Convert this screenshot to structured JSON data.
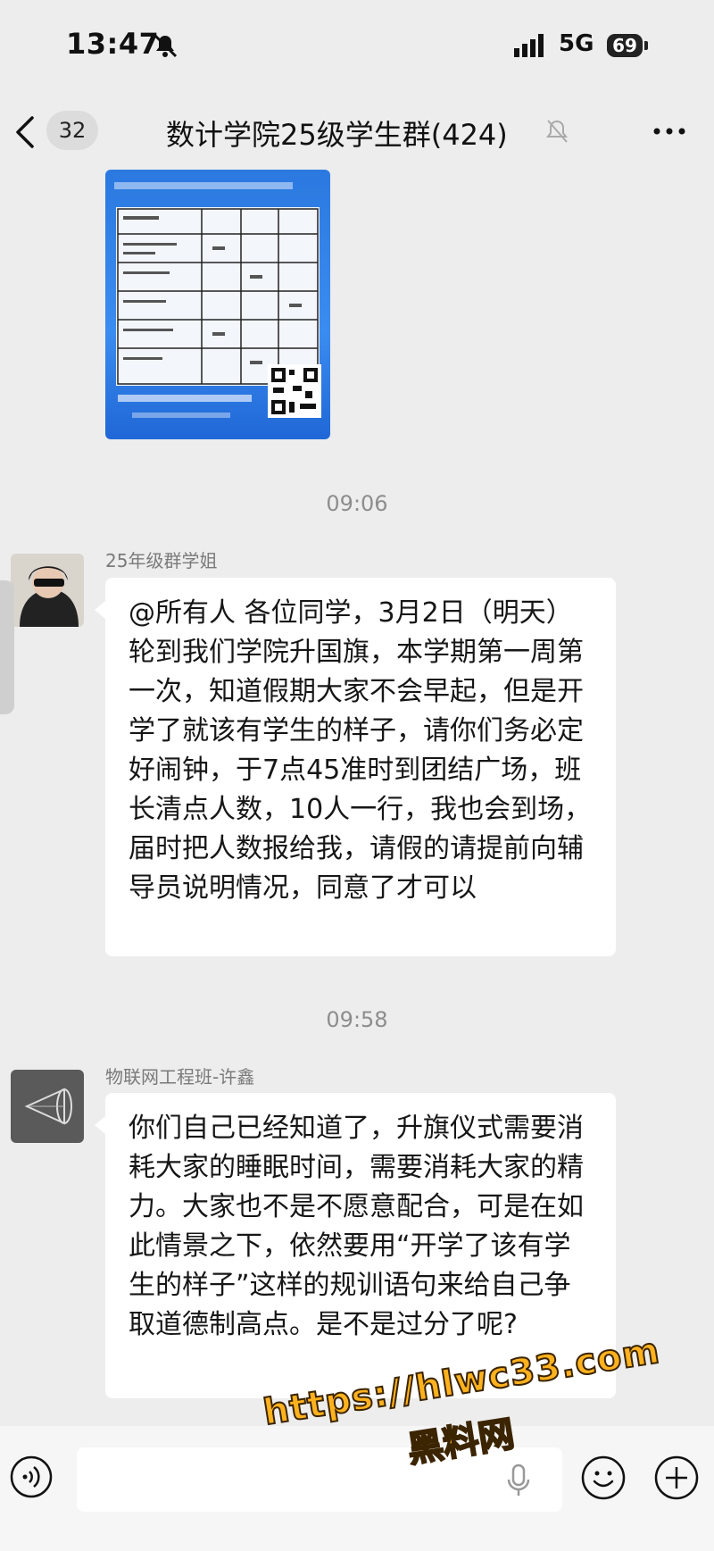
{
  "status_bar": {
    "time": "13:47",
    "network": "5G",
    "battery": "69"
  },
  "nav": {
    "unread_count": "32",
    "title": "数计学院25级学生群(424)"
  },
  "messages": [
    {
      "timestamp": "09:06",
      "sender": "25年级群学姐",
      "text": "@所有人 各位同学，3月2日（明天）轮到我们学院升国旗，本学期第一周第一次，知道假期大家不会早起，但是开学了就该有学生的样子，请你们务必定好闹钟，于7点45准时到团结广场，班长清点人数，10人一行，我也会到场，届时把人数报给我，请假的请提前向辅导员说明情况，同意了才可以"
    },
    {
      "timestamp": "09:58",
      "sender": "物联网工程班-许鑫",
      "text": "你们自己已经知道了，升旗仪式需要消耗大家的睡眠时间，需要消耗大家的精力。大家也不是不愿意配合，可是在如此情景之下，依然要用“开学了该有学生的样子”这样的规训语句来给自己争取道德制高点。是不是过分了呢?"
    }
  ],
  "watermark": {
    "url": "https://hlwc33.com",
    "name": "黑料网"
  },
  "colors": {
    "background": "#ededed",
    "bubble": "#ffffff",
    "card_blue": "#2b79e0",
    "watermark": "#ffb21e"
  }
}
